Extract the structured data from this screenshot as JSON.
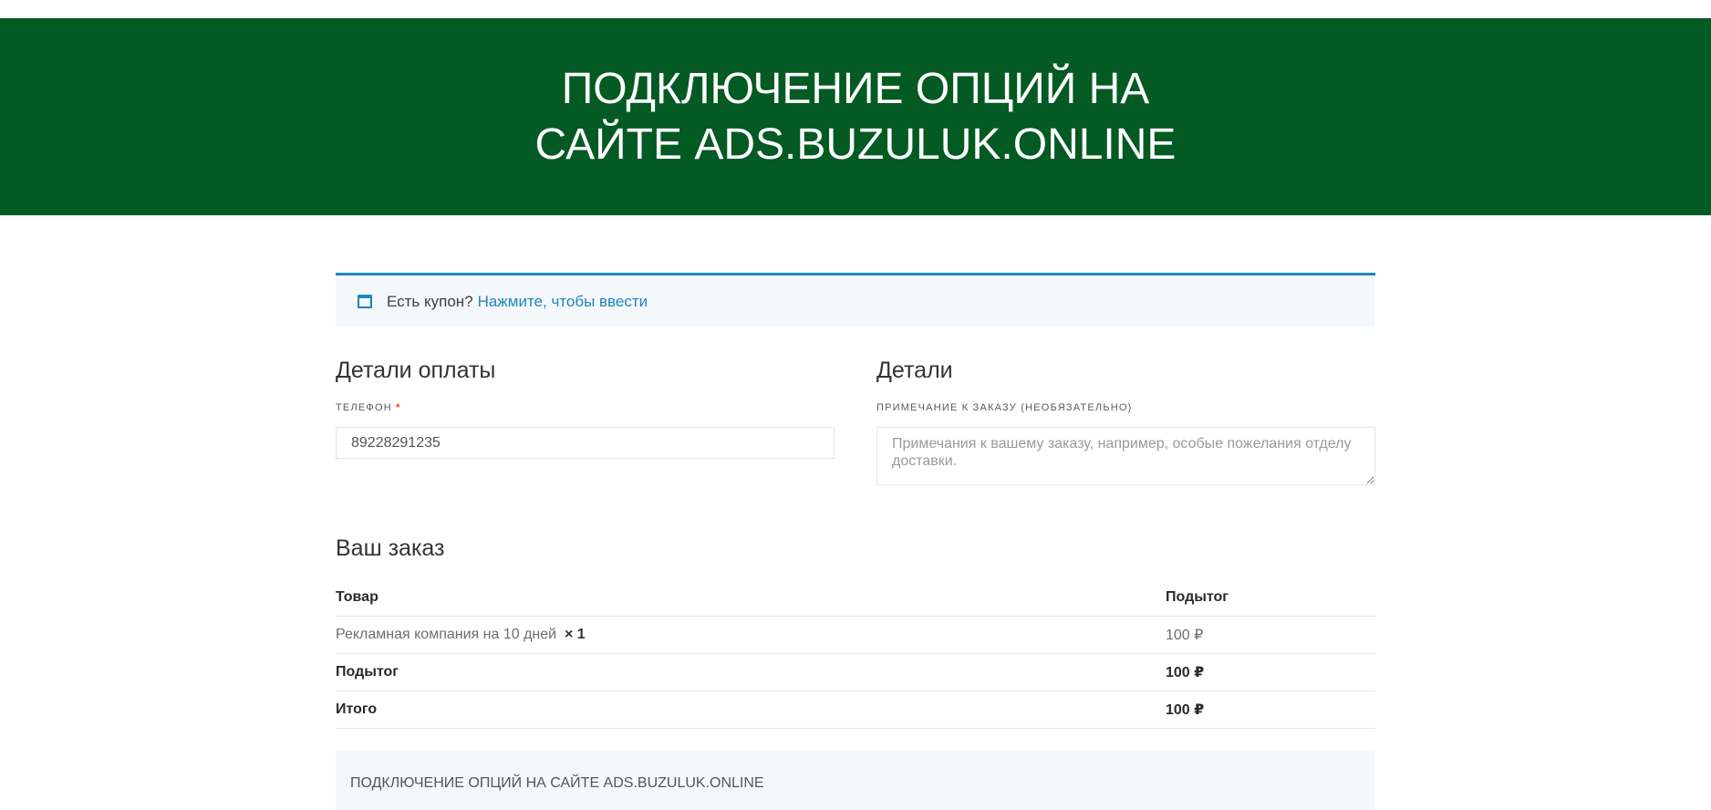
{
  "hero": {
    "title": "ПОДКЛЮЧЕНИЕ ОПЦИЙ НА САЙТЕ ADS.BUZULUK.ONLINE"
  },
  "coupon": {
    "text": "Есть купон?",
    "link": "Нажмите, чтобы ввести",
    "icon": "calendar-icon"
  },
  "billing": {
    "heading": "Детали оплаты",
    "phone_label": "ТЕЛЕФОН",
    "required_mark": "*",
    "phone_value": "89228291235"
  },
  "details": {
    "heading": "Детали",
    "notes_label": "ПРИМЕЧАНИЕ К ЗАКАЗУ (НЕОБЯЗАТЕЛЬНО)",
    "notes_placeholder": "Примечания к вашему заказу, например, особые пожелания отделу доставки."
  },
  "order": {
    "heading": "Ваш заказ",
    "columns": [
      "Товар",
      "Подытог"
    ],
    "items": [
      {
        "name": "Рекламная компания на 10 дней",
        "qty": "× 1",
        "subtotal": "100 ₽"
      }
    ],
    "subtotal_label": "Подытог",
    "subtotal_value": "100 ₽",
    "total_label": "Итого",
    "total_value": "100 ₽"
  },
  "payment": {
    "method": "ПОДКЛЮЧЕНИЕ ОПЦИЙ НА САЙТЕ ADS.BUZULUK.ONLINE"
  },
  "colors": {
    "hero_bg": "#035a23",
    "accent": "#1e85be",
    "required": "#e2401c"
  }
}
